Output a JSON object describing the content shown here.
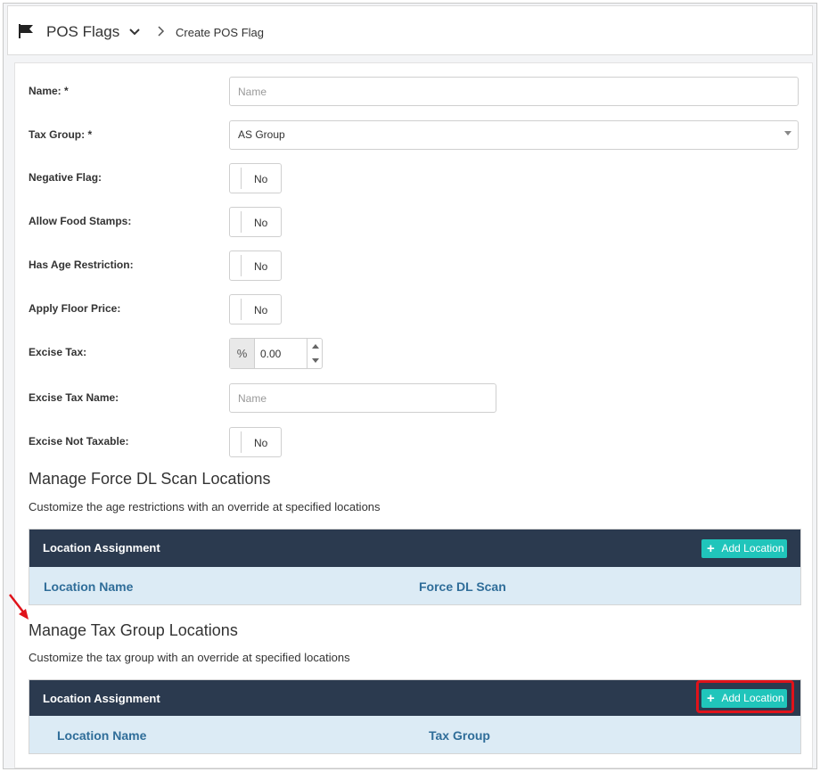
{
  "header": {
    "title": "POS Flags",
    "breadcrumb": "Create POS Flag",
    "icons": [
      "flag-icon",
      "chevron-down-icon",
      "chevron-right-icon"
    ]
  },
  "form": {
    "name": {
      "label": "Name: *",
      "placeholder": "Name",
      "value": ""
    },
    "tax_group": {
      "label": "Tax Group: *",
      "value": "AS Group"
    },
    "negative_flag": {
      "label": "Negative Flag:",
      "value": "No"
    },
    "allow_food_stamps": {
      "label": "Allow Food Stamps:",
      "value": "No"
    },
    "has_age_restriction": {
      "label": "Has Age Restriction:",
      "value": "No"
    },
    "apply_floor_price": {
      "label": "Apply Floor Price:",
      "value": "No"
    },
    "excise_tax": {
      "label": "Excise Tax:",
      "unit": "%",
      "value": "0.00"
    },
    "excise_tax_name": {
      "label": "Excise Tax Name:",
      "placeholder": "Name",
      "value": ""
    },
    "excise_not_taxable": {
      "label": "Excise Not Taxable:",
      "value": "No"
    }
  },
  "force_dl": {
    "title": "Manage Force DL Scan Locations",
    "subtitle": "Customize the age restrictions with an override at specified locations",
    "table_title": "Location Assignment",
    "add_button": "Add Location",
    "columns": [
      "Location Name",
      "Force DL Scan"
    ]
  },
  "tax_group_locations": {
    "title": "Manage Tax Group Locations",
    "subtitle": "Customize the tax group with an override at specified locations",
    "table_title": "Location Assignment",
    "add_button": "Add Location",
    "columns": [
      "Location Name",
      "Tax Group"
    ]
  },
  "colors": {
    "table_header": "#2b3a4f",
    "add_button": "#20c5bb",
    "column_header_bg": "#dcebf5",
    "column_text": "#2f6d99",
    "annotation": "#e0121a"
  }
}
